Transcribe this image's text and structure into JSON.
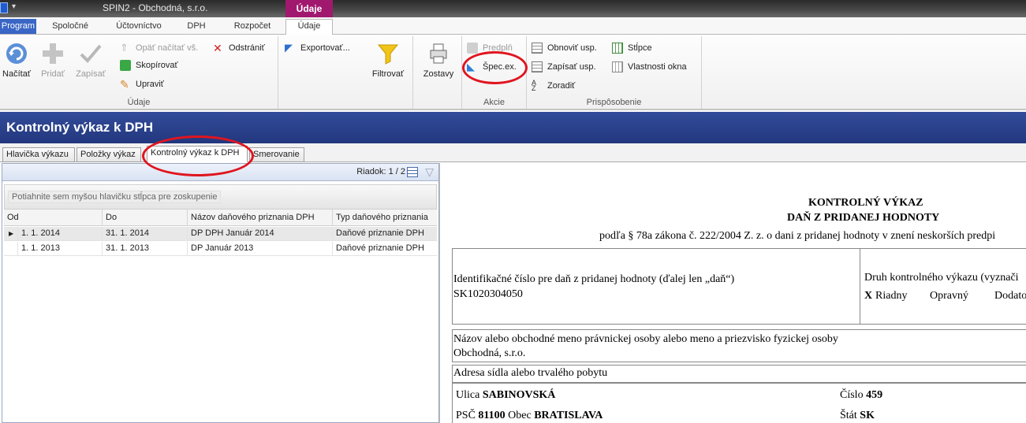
{
  "window": {
    "title": "SPIN2 - Obchodná, s.r.o.",
    "context_tab": "Údaje"
  },
  "ribbon_tabs": [
    "Program",
    "Spoločné",
    "Účtovníctvo",
    "DPH",
    "Rozpočet",
    "Údaje"
  ],
  "ribbon": {
    "big": {
      "load": "Načítať",
      "add": "Pridať",
      "save": "Zapísať",
      "filter": "Filtrovať",
      "reports": "Zostavy"
    },
    "udaje": {
      "reload_all": "Opäť načítať vš.",
      "remove": "Odstrániť",
      "copy": "Skopírovať",
      "edit": "Upraviť",
      "group_label": "Údaje"
    },
    "export": "Exportovať...",
    "akcie": {
      "prefill": "Predplň",
      "spec": "Špec.ex.",
      "group_label": "Akcie"
    },
    "prisp": {
      "refresh_layout": "Obnoviť usp.",
      "columns": "Stĺpce",
      "save_layout": "Zapísať usp.",
      "window_props": "Vlastnosti okna",
      "sort": "Zoradiť",
      "group_label": "Prispôsobenie"
    }
  },
  "header_title": "Kontrolný výkaz k DPH",
  "form_tabs": [
    "Hlavička výkazu",
    "Položky výkaz",
    "Kontrolný výkaz k DPH",
    "Smerovanie"
  ],
  "grid": {
    "row_indicator": "Riadok: 1 / 2",
    "group_hint": "Potiahnite sem myšou hlavičku stĺpca pre zoskupenie",
    "columns": [
      "Od",
      "Do",
      "Názov daňového priznania DPH",
      "Typ daňového priznania"
    ],
    "rows": [
      [
        "1. 1. 2014",
        "31. 1. 2014",
        "DP DPH Január 2014",
        "Daňové priznanie DPH"
      ],
      [
        "1. 1. 2013",
        "31. 1. 2013",
        "DP Január 2013",
        "Daňové priznanie DPH"
      ]
    ]
  },
  "report": {
    "title1": "KONTROLNÝ VÝKAZ",
    "title2": "DAŇ Z PRIDANEJ HODNOTY",
    "law": "podľa § 78a zákona č. 222/2004 Z. z. o dani z pridanej hodnoty v znení neskorších predpi",
    "dic_label": "Identifikačné číslo pre daň z pridanej hodnoty (ďalej len „daň“)",
    "dic_value": "SK1020304050",
    "type_label": "Druh kontrolného výkazu (vyznači",
    "type_x": "X",
    "type_regular": "Riadny",
    "type_corrective": "Opravný",
    "type_additional": "Dodato",
    "name_label": "Názov alebo obchodné meno právnickej osoby alebo meno a priezvisko fyzickej osoby",
    "name_value": "Obchodná, s.r.o.",
    "address_label": "Adresa sídla alebo trvalého pobytu",
    "street_label": "Ulica",
    "street_value": "SABINOVSKÁ",
    "number_label": "Číslo",
    "number_value": "459",
    "zip_label": "PSČ",
    "zip_value": "81100",
    "city_label": "Obec",
    "city_value": "BRATISLAVA",
    "country_label": "Štát",
    "country_value": "SK"
  }
}
